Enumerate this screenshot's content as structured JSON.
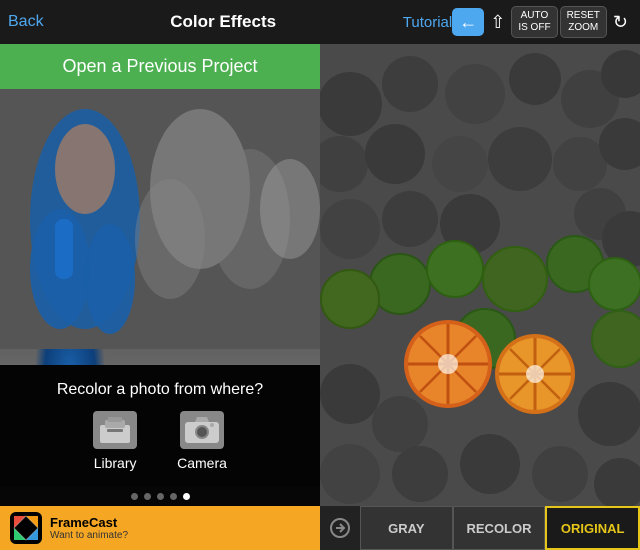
{
  "nav": {
    "back_label": "Back",
    "title": "Color Effects",
    "tutorial_label": "Tutorial",
    "auto_label": "AUTO\nIS OFF",
    "reset_label": "RESET\nZOOM"
  },
  "left_panel": {
    "open_previous_label": "Open a Previous Project",
    "recolor_title": "Recolor a photo from where?",
    "library_label": "Library",
    "camera_label": "Camera",
    "dots_count": 5,
    "active_dot": 4
  },
  "framecast": {
    "name": "FrameCast",
    "subtitle": "Want to animate?"
  },
  "bottom_toolbar": {
    "gray_label": "GRAY",
    "recolor_label": "RECOLOR",
    "original_label": "ORIGINAL"
  }
}
